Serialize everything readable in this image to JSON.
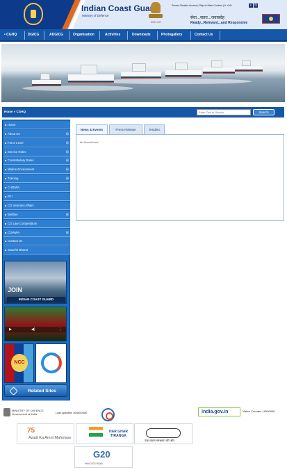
{
  "header": {
    "org_title": "Indian Coast Guard",
    "org_subtitle": "Ministry of Defence",
    "emblem_caption": "सत्यमेव जयते",
    "utility_links": "Screen Reader Access | Skip to Main Content | A- A A+",
    "lang_icons": [
      "E",
      "हि"
    ],
    "motto_hindi": "सेवा...सतत...जवाबदेह",
    "motto_english": "Ready...Relevant...and Responsive"
  },
  "nav": {
    "items": [
      {
        "label": "• CGHQ"
      },
      {
        "label": "DGICG"
      },
      {
        "label": "ADGICG"
      },
      {
        "label": "Organisation"
      },
      {
        "label": "Activities"
      },
      {
        "label": "Downloads"
      },
      {
        "label": "Photogallery"
      },
      {
        "label": "Contact Us"
      }
    ]
  },
  "breadcrumb": {
    "text": "Home » CGHQ"
  },
  "search": {
    "placeholder": "Enter Text to Search",
    "button_label": "Search"
  },
  "sidebar": {
    "items": [
      {
        "label": "Home",
        "expandable": false
      },
      {
        "label": "About Us",
        "expandable": true
      },
      {
        "label": "Force Level",
        "expandable": true
      },
      {
        "label": "Service Roles",
        "expandable": true
      },
      {
        "label": "Constabulary Roles",
        "expandable": true
      },
      {
        "label": "Marine Environment",
        "expandable": true
      },
      {
        "label": "Training",
        "expandable": true
      },
      {
        "label": "C-SEWA",
        "expandable": false
      },
      {
        "label": "RTI",
        "expandable": false
      },
      {
        "label": "CG Veterans Affairs",
        "expandable": false
      },
      {
        "label": "Welfare",
        "expandable": true
      },
      {
        "label": "CG Law Compendium",
        "expandable": false
      },
      {
        "label": "CGWWA",
        "expandable": true
      },
      {
        "label": "Contact Us",
        "expandable": false
      },
      {
        "label": "Swachh Bharat",
        "expandable": false
      }
    ],
    "join_title": "JOIN",
    "join_subtitle": "INDIAN COAST GUARD",
    "ncc_label": "NCC",
    "related_sites": "Related Sites"
  },
  "tabs": {
    "items": [
      {
        "label": "News & Events",
        "active": true
      },
      {
        "label": "Press Release",
        "active": false
      },
      {
        "label": "Tenders",
        "active": false
      }
    ],
    "content_text": "No Record found"
  },
  "footer": {
    "ministry_line1": "MINISTRY OF DEFENCE",
    "ministry_line2": "Government of India",
    "last_updated": "Last updated: 00/00/0000",
    "india_gov": "india.gov.in",
    "visitor_counter": "Visitor Counter: 10000000",
    "azadi_big": "75",
    "azadi_small": "Azadi Ka Amrit Mahotsav",
    "ghar_tiranga": "HAR GHAR TIRANGA",
    "swachh_text": "एक कदम स्वच्छता की ओर",
    "g20_big": "G20",
    "g20_small": "भारत 2023 INDIA"
  },
  "colors": {
    "nav_blue": "#1557a8",
    "sidebar_blue": "#1e6bbf",
    "title_navy": "#163a7d",
    "accent_orange": "#e06a1e"
  }
}
